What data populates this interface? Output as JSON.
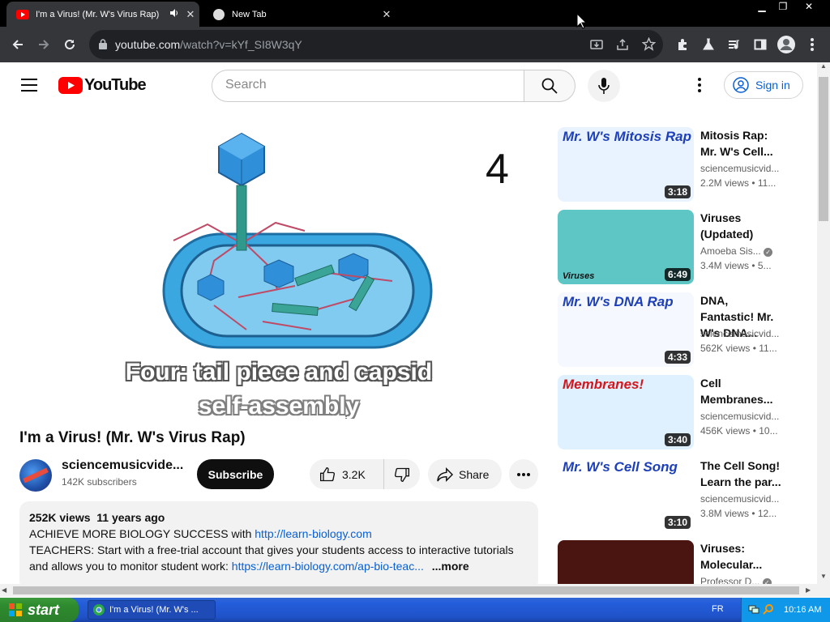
{
  "browser": {
    "tabs": [
      {
        "title": "I'm a Virus! (Mr. W's Virus Rap)",
        "active": true
      },
      {
        "title": "New Tab",
        "active": false
      }
    ],
    "url_host": "youtube.com",
    "url_path": "/watch?v=kYf_SI8W3qY"
  },
  "yt": {
    "logo_text": "YouTube",
    "search_placeholder": "Search",
    "signin_label": "Sign in"
  },
  "video": {
    "step_number": "4",
    "caption_line1": "Four: tail piece and capsid",
    "caption_line2": "self-assembly",
    "title": "I'm a Virus! (Mr. W's Virus Rap)",
    "channel": "sciencemusicvide...",
    "subscribers": "142K subscribers",
    "subscribe_label": "Subscribe",
    "likes": "3.2K",
    "share_label": "Share"
  },
  "description": {
    "views": "252K views",
    "age": "11 years ago",
    "line1_text": "ACHIEVE MORE BIOLOGY SUCCESS with ",
    "line1_link": "http://learn-biology.com",
    "line2": "TEACHERS: Start with a free-trial account that gives your students access to interactive tutorials",
    "line3_text": "and allows you to monitor student work: ",
    "line3_link": "https://learn-biology.com/ap-bio-teac...",
    "more_label": "...more"
  },
  "recommendations": [
    {
      "title": "Mitosis Rap: Mr. W's Cell...",
      "channel": "sciencemusicvid...",
      "meta": "2.2M views • 11...",
      "duration": "3:18",
      "thumb_text": "Mr. W's Mitosis Rap",
      "thumb_color": "#e9f3ff"
    },
    {
      "title": "Viruses (Updated)",
      "channel": "Amoeba Sis...",
      "meta": "3.4M views • 5...",
      "duration": "6:49",
      "thumb_text": "Viruses",
      "thumb_color": "#5ec7c6",
      "verified": true
    },
    {
      "title": "DNA, Fantastic! Mr. W's DNA...",
      "channel": "sciencemusicvid...",
      "meta": "562K views • 11...",
      "duration": "4:33",
      "thumb_text": "Mr. W's DNA Rap",
      "thumb_color": "#f5f8ff"
    },
    {
      "title": "Cell Membranes...",
      "channel": "sciencemusicvid...",
      "meta": "456K views • 10...",
      "duration": "3:40",
      "thumb_text": "Membranes!",
      "thumb_color": "#dff1ff"
    },
    {
      "title": "The Cell Song! Learn the par...",
      "channel": "sciencemusicvid...",
      "meta": "3.8M views • 12...",
      "duration": "3:10",
      "thumb_text": "Mr. W's Cell Song",
      "thumb_color": "#ffffff"
    },
    {
      "title": "Viruses: Molecular...",
      "channel": "Professor D...",
      "meta": "",
      "duration": "",
      "thumb_text": "",
      "thumb_color": "#4a1410",
      "verified": true
    }
  ],
  "taskbar": {
    "start_label": "start",
    "task_label": "I'm a Virus! (Mr. W's ...",
    "lang": "FR",
    "clock": "10:16 AM"
  }
}
